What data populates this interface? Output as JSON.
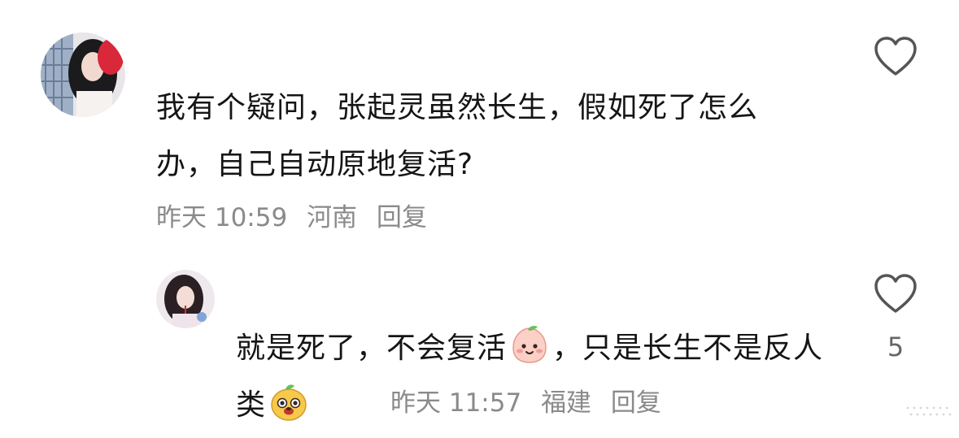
{
  "comments": [
    {
      "text": "我有个疑问，张起灵虽然长生，假如死了怎么办，自己自动原地复活?",
      "time": "昨天 10:59",
      "location": "河南",
      "reply_label": "回复",
      "like_count": ""
    }
  ],
  "replies": [
    {
      "text_part1": "就是死了，不会复活",
      "emoji1": "peach-smile-emoji",
      "text_part2": "，只是长生不是反人类",
      "emoji2": "dog-face-emoji",
      "time": "昨天 11:57",
      "location": "福建",
      "reply_label": "回复",
      "like_count": "5"
    }
  ],
  "colors": {
    "text": "#151515",
    "meta": "#8a8a8a",
    "icon": "#555555"
  }
}
